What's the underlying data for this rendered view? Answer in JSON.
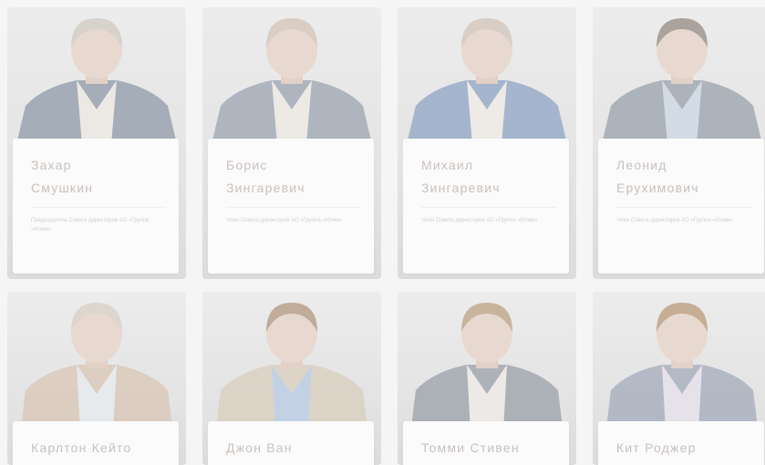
{
  "board": [
    {
      "first": "Захар",
      "last": "Смушкин",
      "role": "Председатель Совета директоров АО «Группа «Илим»",
      "suit": "#8f9aa8",
      "shirt": "#ece8e4",
      "hair": "#d7d2cc"
    },
    {
      "first": "Борис",
      "last": "Зингаревич",
      "role": "Член Совета директоров АО «Группа «Илим»",
      "suit": "#9ba4b2",
      "shirt": "#ede9e5",
      "hair": "#d9cdc4"
    },
    {
      "first": "Михаил",
      "last": "Зингаревич",
      "role": "Член Совета директоров АО «Группа «Илим»",
      "suit": "#8ea4c4",
      "shirt": "#eeeae6",
      "hair": "#d8cec6"
    },
    {
      "first": "Леонид",
      "last": "Ерухимович",
      "role": "Член Совета директоров АО «Группа «Илим»",
      "suit": "#9aa2ac",
      "shirt": "#d3dbe6",
      "hair": "#aaa29c"
    },
    {
      "name": "Карлтон Кейто",
      "suit": "#d8c6b4",
      "shirt": "#e7eaed",
      "hair": "#ddd6ce"
    },
    {
      "name": "Джон Ван",
      "suit": "#d9cdbd",
      "shirt": "#c2d2e4",
      "hair": "#c0ac98"
    },
    {
      "name": "Томми Стивен",
      "suit": "#9aa0a8",
      "shirt": "#ece9e6",
      "hair": "#c8b39c"
    },
    {
      "name": "Кит Роджер",
      "suit": "#a3abb9",
      "shirt": "#e6e2ea",
      "hair": "#c6ad95"
    }
  ]
}
